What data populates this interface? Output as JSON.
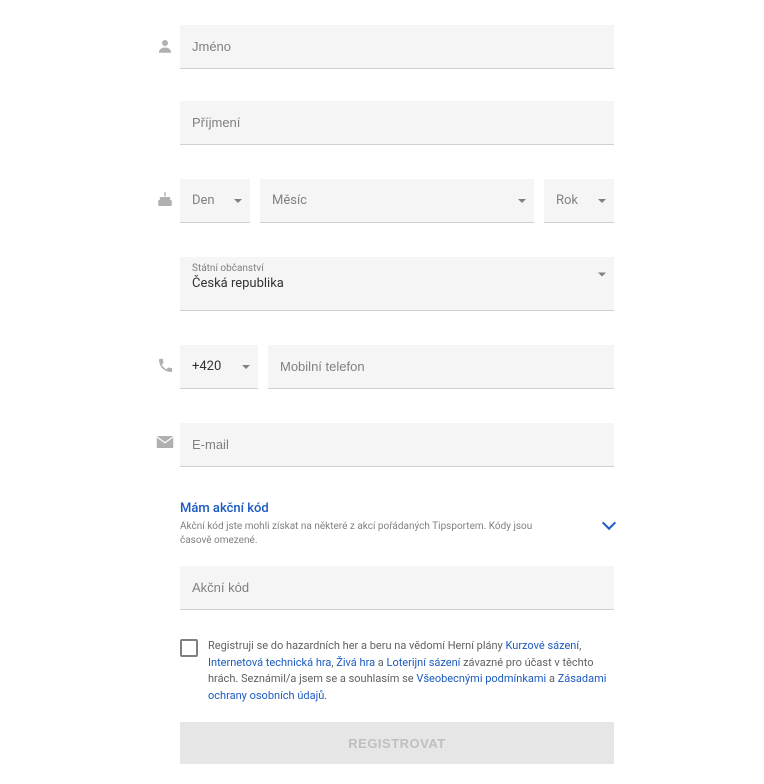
{
  "name": {
    "placeholder": "Jméno"
  },
  "surname": {
    "placeholder": "Příjmení"
  },
  "dob": {
    "day": "Den",
    "month": "Měsíc",
    "year": "Rok"
  },
  "citizenship": {
    "label": "Státní občanství",
    "value": "Česká republika"
  },
  "phone": {
    "code": "+420",
    "placeholder": "Mobilní telefon"
  },
  "email": {
    "placeholder": "E-mail"
  },
  "promo": {
    "title": "Mám akční kód",
    "desc": "Akční kód jste mohli získat na některé z akcí pořádaných Tipsportem. Kódy jsou časově omezené.",
    "input_placeholder": "Akční kód"
  },
  "consent": {
    "pre": "Registruji se do hazardních her a beru na vědomí Herní plány ",
    "link1": "Kurzové sázení",
    "sep1": ", ",
    "link2": "Internetová technická hra",
    "sep2": ", ",
    "link3": "Živá hra",
    "sep3": " a ",
    "link4": "Loterijní sázení",
    "mid": " závazné pro účast v těchto hrách. Seznámil/a jsem se a souhlasím se ",
    "link5": "Všeobecnými podmínkami",
    "sep4": " a ",
    "link6": "Zásadami ochrany osobních údajů",
    "end": "."
  },
  "submit": "REGISTROVAT"
}
